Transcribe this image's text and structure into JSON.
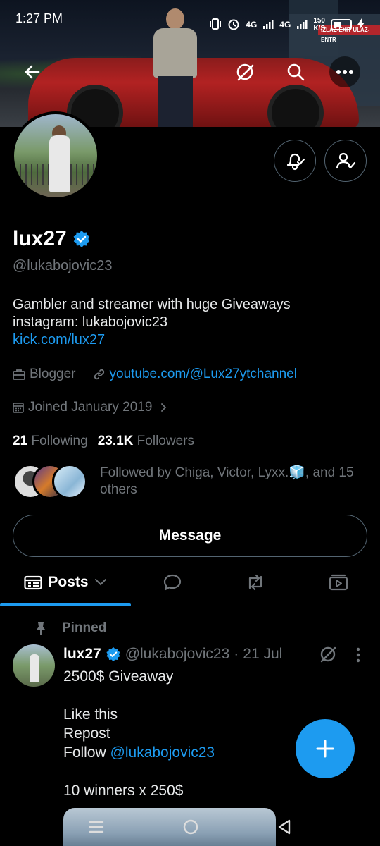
{
  "status_bar": {
    "time": "1:27 PM",
    "network_label_1": "4G",
    "network_label_2": "4G",
    "speed_value": "150",
    "speed_unit": "K/S"
  },
  "banner": {
    "sign_text": "IZLAZ-EXIT  ULAZ-ENTR"
  },
  "profile": {
    "display_name": "lux27",
    "handle": "@lukabojovic23",
    "bio_line1": "Gambler and streamer with huge Giveaways",
    "bio_line2": "instagram: lukabojovic23",
    "bio_link": "kick.com/lux27",
    "category": "Blogger",
    "website": "youtube.com/@Lux27ytchannel",
    "joined": "Joined January 2019",
    "following_count": "21",
    "following_label": "Following",
    "followers_count": "23.1K",
    "followers_label": "Followers",
    "followed_by": "Followed by Chiga, Victor, Lyxx.🧊, and 15 others",
    "message_button": "Message"
  },
  "tabs": {
    "active_label": "Posts"
  },
  "pinned_post": {
    "pinned_label": "Pinned",
    "author_name": "lux27",
    "author_handle": "@lukabojovic23",
    "separator": "·",
    "date": "21 Jul",
    "line1": "2500$ Giveaway",
    "line2": "Like this",
    "line3": "Repost",
    "line4_prefix": "Follow",
    "line4_mention": "@lukabojovic23",
    "line5": "10 winners x 250$"
  },
  "colors": {
    "accent": "#1d9bf0",
    "background": "#000000",
    "secondary_text": "#71767b",
    "border": "#536471"
  }
}
